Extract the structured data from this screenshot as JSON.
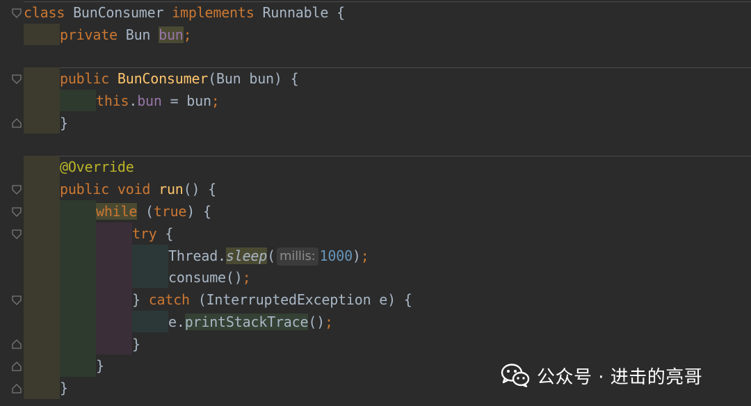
{
  "editor": {
    "lines": [
      [
        "class",
        " ",
        "BunConsumer",
        " ",
        "implements",
        " ",
        "Runnable",
        " {"
      ],
      [
        "private",
        " ",
        "Bun",
        " ",
        "bun",
        ";"
      ],
      [],
      [
        "public",
        " ",
        "BunConsumer",
        "(",
        "Bun",
        " bun) {"
      ],
      [
        "this",
        ".",
        "bun",
        " = bun",
        ";"
      ],
      [
        "}"
      ],
      [],
      [
        "@Override"
      ],
      [
        "public",
        " ",
        "void",
        " ",
        "run",
        "() {"
      ],
      [
        "while",
        " (",
        "true",
        ") {"
      ],
      [
        "try",
        " {"
      ],
      [
        "Thread.",
        "sleep",
        "(",
        "millis:",
        "1000",
        ")",
        ";"
      ],
      [
        "consume",
        "()",
        ";"
      ],
      [
        "} ",
        "catch",
        " (InterruptedException e) {"
      ],
      [
        "e.",
        "printStackTrace",
        "()",
        ";"
      ],
      [
        "}"
      ],
      [
        "}"
      ],
      [
        "}"
      ]
    ],
    "token_colors": {
      "keyword": "#cc7832",
      "method_decl": "#ffc66d",
      "field": "#9876aa",
      "annotation": "#bbb529",
      "number": "#6897bb",
      "plain": "#a9b7c6",
      "inlay_hint": "#8d8d8d"
    }
  },
  "watermark": {
    "text": "公众号 · 进击的亮哥",
    "icon": "wechat-icon"
  },
  "colors": {
    "background": "#2b2b2b",
    "indent_class": "#3c3b2e",
    "indent_method": "#2f3a2f",
    "indent_try": "#3a2e38",
    "indent_inner": "#2b3837"
  }
}
